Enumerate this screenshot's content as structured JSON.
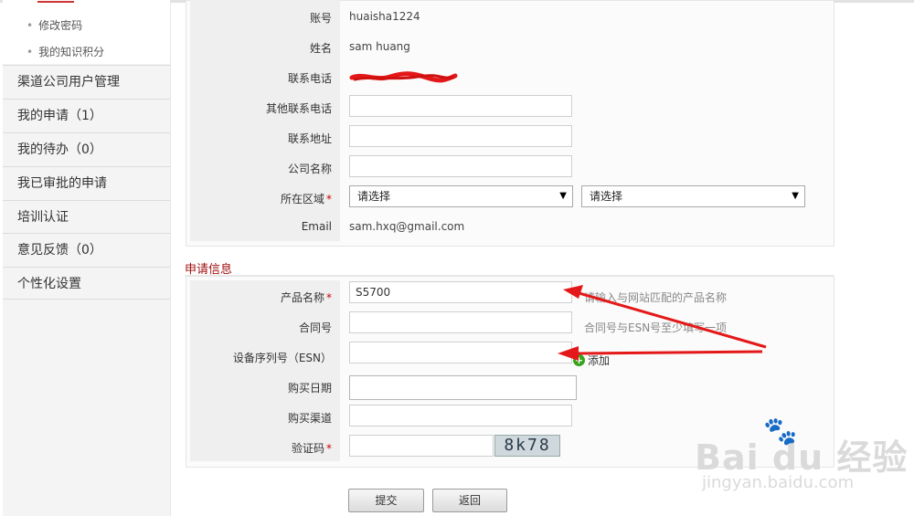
{
  "sidebar": {
    "sub_items": [
      {
        "label": "修改密码"
      },
      {
        "label": "我的知识积分"
      }
    ],
    "items": [
      {
        "label": "渠道公司用户管理"
      },
      {
        "label": "我的申请（1）"
      },
      {
        "label": "我的待办（0）"
      },
      {
        "label": "我已审批的申请"
      },
      {
        "label": "培训认证"
      },
      {
        "label": "意见反馈（0）"
      },
      {
        "label": "个性化设置"
      }
    ]
  },
  "user_info": {
    "account_label": "账号",
    "account_value": "huaisha1224",
    "name_label": "姓名",
    "name_value": "sam huang",
    "phone_label": "联系电话",
    "other_phone_label": "其他联系电话",
    "address_label": "联系地址",
    "company_label": "公司名称",
    "region_label": "所在区域",
    "region_select_1": "请选择",
    "region_select_2": "请选择",
    "email_label": "Email",
    "email_value": "sam.hxq@gmail.com"
  },
  "application": {
    "section_title": "申请信息",
    "product_label": "产品名称",
    "product_value": "S5700",
    "product_hint": "请输入与网站匹配的产品名称",
    "contract_label": "合同号",
    "contract_hint": "合同号与ESN号至少填写一项",
    "esn_label": "设备序列号（ESN）",
    "add_label": "添加",
    "purchase_date_label": "购买日期",
    "purchase_channel_label": "购买渠道",
    "captcha_label": "验证码",
    "captcha_text": "8k78"
  },
  "buttons": {
    "submit": "提交",
    "back": "返回"
  },
  "watermark": {
    "brand": "Bai du 经验",
    "url": "jingyan.baidu.com"
  },
  "colors": {
    "required": "#cc0000",
    "section_title": "#a01010",
    "annotation_arrow": "#e41818",
    "add_icon": "#38a31c"
  }
}
